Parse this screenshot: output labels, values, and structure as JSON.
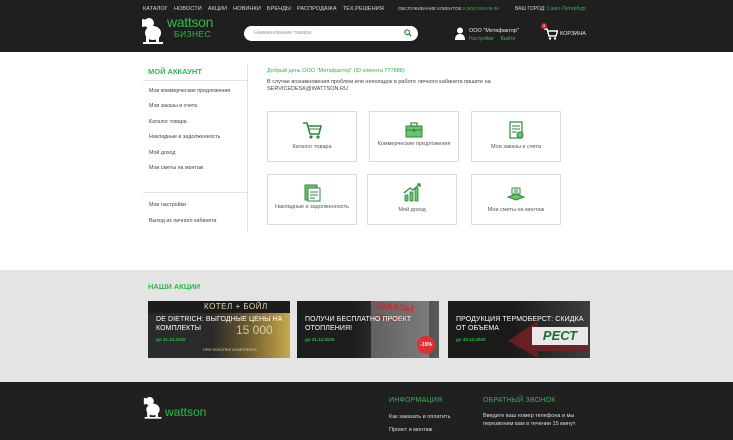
{
  "header": {
    "nav": [
      "КАТАЛОГ",
      "НОВОСТИ",
      "АКЦИИ",
      "НОВИНКИ",
      "БРЕНДЫ",
      "РАСПРОДАЖА",
      "ТЕХ.РЕШЕНИЯ"
    ],
    "service_label": "ОБСЛУЖИВАНИЕ КЛИЕНТОВ",
    "service_phone": "8 (800) 500-09-09",
    "city_label": "ВАШ ГОРОД:",
    "city_value": "Санкт-Петербург",
    "logo_word": "wattson",
    "logo_sub": "БИЗНЕС",
    "search_placeholder": "Наименование товара",
    "account_name": "ООО \"Метафактор\"",
    "account_settings": "Настройки",
    "account_logout": "Выйти",
    "cart_count": "3",
    "cart_label": "КОРЗИНА"
  },
  "sidebar": {
    "title": "МОЙ АККАУНТ",
    "items": [
      "Мои коммерческие предложения",
      "Мои заказы и счета",
      "Каталог товара",
      "Накладные и задолженность",
      "Мой доход",
      "Мои сметы на монтаж"
    ],
    "bottom_items": [
      "Мои настройки",
      "Выход из личного кабинета"
    ]
  },
  "main": {
    "greeting": "Добрый день ООО \"Метафактор\" (ID клиента 777888)",
    "info": "В случае возникновения проблем или неполадок в работе личного кабинета пишите на",
    "email": "SERVICEDESK@WATTSON.RU",
    "cards": [
      {
        "label": "Каталог товара",
        "icon": "cart-icon"
      },
      {
        "label": "Коммерческие предложения",
        "icon": "briefcase-icon"
      },
      {
        "label": "Мои заказы и счета",
        "icon": "document-icon"
      },
      {
        "label": "Накладные и задолженность",
        "icon": "invoice-icon"
      },
      {
        "label": "Мой доход",
        "icon": "growth-chart-icon"
      },
      {
        "label": "Мои сметы на монтаж",
        "icon": "estimate-icon"
      }
    ]
  },
  "promos": {
    "title": "НАШИ АКЦИИ",
    "banners": [
      {
        "headline": "DE DIETRICH: ВЫГОДНЫЕ ЦЕНЫ НА КОМПЛЕКТЫ",
        "date": "до 31.12.2020",
        "art": "КОТЕЛ + БОЙЛ",
        "art2": "15 000",
        "note": "ПРИ ПОКУПКЕ КОМПЛЕКТА"
      },
      {
        "headline": "ПОЛУЧИ БЕСПЛАТНО ПРОЕКТ ОТОПЛЕНИЯ!",
        "date": "до 31.12.2020",
        "art": "ЗАКАЗЫ",
        "art2": "ПРОЕКТ",
        "badge": "-15%"
      },
      {
        "headline": "ПРОДУКЦИЯ ТЕРМОБЕРСТ: СКИДКА ОТ ОБЪЕМА",
        "date": "до 30.12.2020",
        "art": "РЕСТ"
      }
    ]
  },
  "footer": {
    "logo_word": "wattson",
    "info_title": "ИНФОРМАЦИЯ",
    "info_links": [
      "Как заказать и оплатить",
      "Проект и монтаж"
    ],
    "callback_title": "ОБРАТНЫЙ ЗВОНОК",
    "callback_text": "Введите ваш номер телефона и мы перезвоним вам в течении 15 минут"
  },
  "colors": {
    "accent": "#2fb84a",
    "header_bg": "#1f1f1f",
    "promo_bg": "#e4e4e4"
  }
}
